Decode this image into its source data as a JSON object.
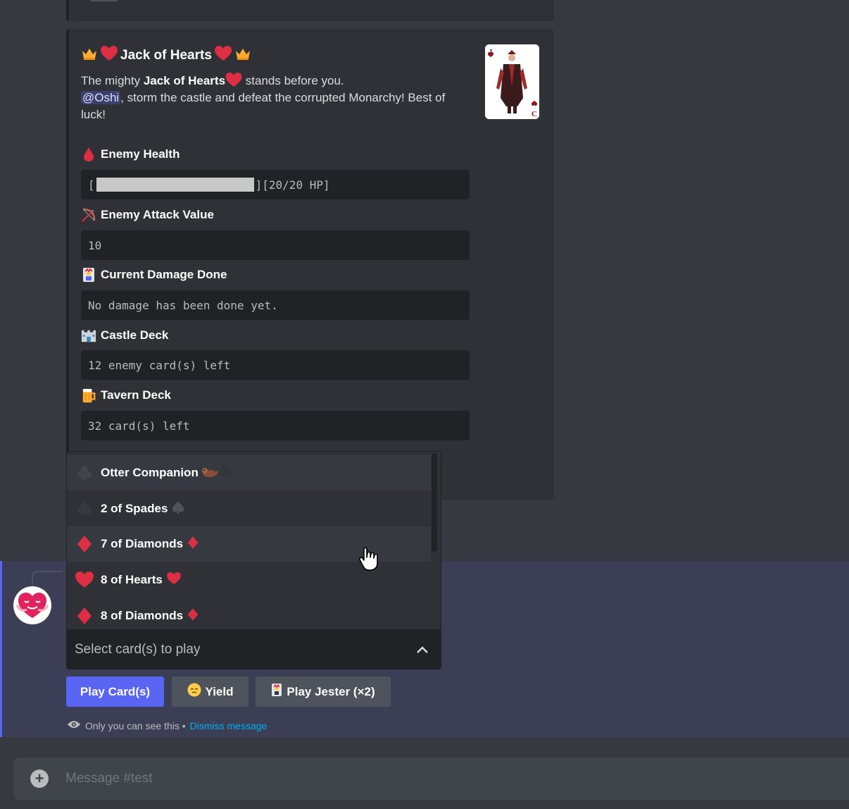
{
  "embed": {
    "title": "Jack of Hearts",
    "desc_prefix": "The mighty ",
    "desc_bold": "Jack of Hearts",
    "desc_suffix": " stands before you.",
    "mention": "@Oshi",
    "mention_text": ", storm the castle and defeat the corrupted Monarchy! Best of luck!",
    "fields": [
      {
        "name": "Enemy Health",
        "icon": "blood-drop-icon",
        "value_open": "[",
        "value_close": "][20/20 HP]",
        "bar_fraction": 1.0
      },
      {
        "name": "Enemy Attack Value",
        "icon": "bow-and-arrow-icon",
        "value": "10"
      },
      {
        "name": "Current Damage Done",
        "icon": "joker-card-icon",
        "value": "No damage has been done yet."
      },
      {
        "name": "Castle Deck",
        "icon": "castle-icon",
        "value": "12 enemy card(s) left"
      },
      {
        "name": "Tavern Deck",
        "icon": "beer-mug-icon",
        "value": "32 card(s) left"
      }
    ]
  },
  "dropdown": {
    "options": [
      {
        "label": "Otter Companion",
        "suit": "club",
        "color": "#2f3136"
      },
      {
        "label": "2 of Spades",
        "suit": "spade",
        "color": "#2f3136"
      },
      {
        "label": "7 of Diamonds",
        "suit": "diamond",
        "color": "#dd2e44"
      },
      {
        "label": "8 of Hearts",
        "suit": "heart",
        "color": "#dd2e44"
      },
      {
        "label": "8 of Diamonds",
        "suit": "diamond",
        "color": "#dd2e44"
      }
    ],
    "placeholder": "Select card(s) to play"
  },
  "buttons": {
    "play": "Play Card(s)",
    "yield": "Yield",
    "jester": "Play Jester (×2)"
  },
  "ephemeral": {
    "text": "Only you can see this •",
    "dismiss": "Dismiss message"
  },
  "composer": {
    "placeholder": "Message #test"
  },
  "colors": {
    "accent": "#5865f2",
    "link": "#00aff4",
    "heart": "#dd2e44"
  }
}
